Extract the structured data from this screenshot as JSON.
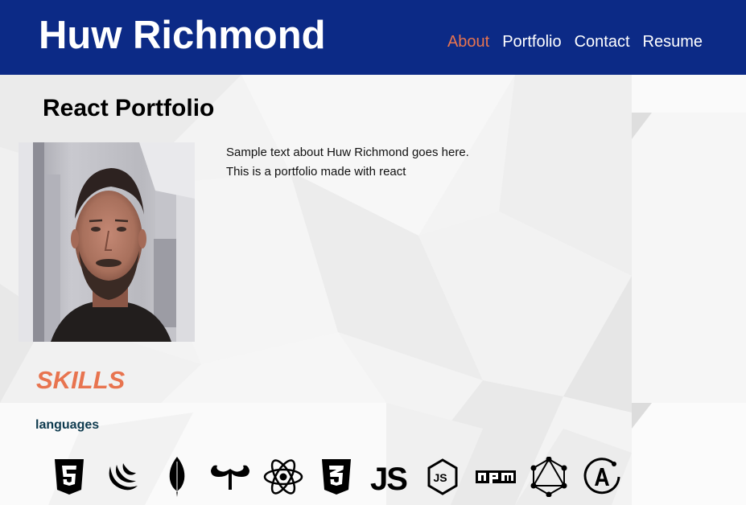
{
  "header": {
    "site_title": "Huw Richmond",
    "nav": [
      {
        "label": "About",
        "active": true
      },
      {
        "label": "Portfolio",
        "active": false
      },
      {
        "label": "Contact",
        "active": false
      },
      {
        "label": "Resume",
        "active": false
      }
    ],
    "background_color": "#0c2a86",
    "active_color": "#e8744f"
  },
  "about": {
    "title": "React Portfolio",
    "photo_icon": "profile-photo",
    "text_lines": [
      "Sample text about Huw Richmond goes here.",
      "This is a portfolio made with react"
    ]
  },
  "skills": {
    "title": "SKILLS",
    "category": "languages",
    "icons": [
      "html5-icon",
      "jquery-icon",
      "mongodb-icon",
      "handlebars-icon",
      "react-icon",
      "css3-icon",
      "javascript-icon",
      "nodejs-icon",
      "npm-icon",
      "graphql-icon",
      "apollo-icon"
    ]
  }
}
